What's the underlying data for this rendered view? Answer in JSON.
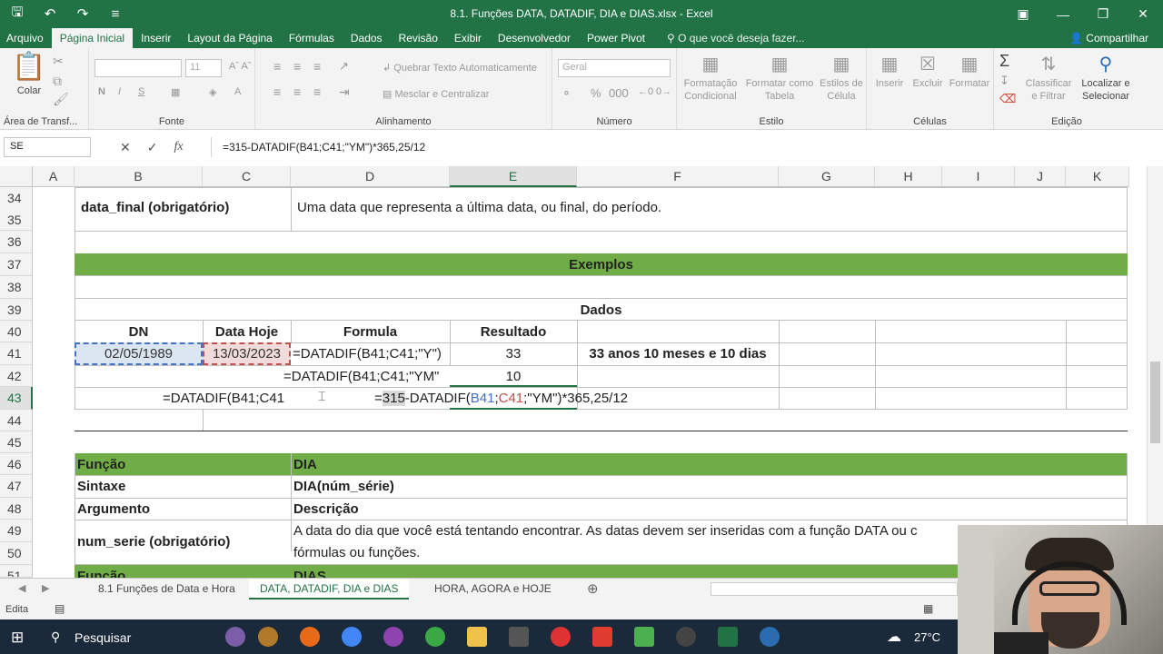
{
  "window": {
    "title": "8.1. Funções DATA, DATADIF, DIA e DIAS.xlsx - Excel"
  },
  "ribbon_tabs": [
    "Arquivo",
    "Página Inicial",
    "Inserir",
    "Layout da Página",
    "Fórmulas",
    "Dados",
    "Revisão",
    "Exibir",
    "Desenvolvedor",
    "Power Pivot"
  ],
  "tell_me": "O que você deseja fazer...",
  "share": "Compartilhar",
  "ribbon": {
    "paste": "Colar",
    "clipboard_group": "Área de Transf...",
    "font_size": "11",
    "font_group": "Fonte",
    "wrap_text": "Quebrar Texto Automaticamente",
    "merge_center": "Mesclar e Centralizar",
    "alignment_group": "Alinhamento",
    "number_format": "Geral",
    "number_group": "Número",
    "cond_format": "Formatação Condicional",
    "format_table": "Formatar como Tabela",
    "cell_styles": "Estilos de Célula",
    "styles_group": "Estilo",
    "insert": "Inserir",
    "delete": "Excluir",
    "format": "Formatar",
    "cells_group": "Células",
    "sort_filter": "Classificar e Filtrar",
    "find_select": "Localizar e Selecionar",
    "editing_group": "Edição"
  },
  "formula_bar": {
    "name_box": "SE",
    "formula": "=315-DATADIF(B41;C41;\"YM\")*365,25/12"
  },
  "columns": [
    "A",
    "B",
    "C",
    "D",
    "E",
    "F",
    "G",
    "H",
    "I",
    "J",
    "K"
  ],
  "rows": [
    "34",
    "35",
    "36",
    "37",
    "38",
    "39",
    "40",
    "41",
    "42",
    "43",
    "44",
    "45",
    "46",
    "47",
    "48",
    "49",
    "50",
    "51"
  ],
  "cells": {
    "b34": "data_final (obrigatório)",
    "d34": "Uma data que representa a última data, ou final, do período.",
    "exemplos": "Exemplos",
    "dados": "Dados",
    "h_dn": "DN",
    "h_hoje": "Data Hoje",
    "h_formula": "Formula",
    "h_resultado": "Resultado",
    "b41": "02/05/1989",
    "c41": "13/03/2023",
    "d41": "=DATADIF(B41;C41;\"Y\")",
    "e41": "33",
    "f41": "33 anos 10 meses e 10 dias",
    "d42": "=DATADIF(B41;C41;\"YM\"",
    "e42": "10",
    "b43": "=DATADIF(B41;C41",
    "e43_pre": "=",
    "e43_315": "315",
    "e43_mid": "-DATADIF(",
    "e43_b41": "B41",
    "e43_sep": ";",
    "e43_c41": "C41",
    "e43_post": ";\"YM\")*365,25/12",
    "b46": "Função",
    "d46": "DIA",
    "b47": "Sintaxe",
    "d47": "DIA(núm_série)",
    "b48": "Argumento",
    "d48": "Descrição",
    "b49": "num_serie (obrigatório)",
    "d49a": "A data do dia que você está tentando encontrar. As datas devem ser inseridas com a função DATA ou c",
    "d49b": "fórmulas ou funções.",
    "b51": "Função",
    "d51": "DIAS"
  },
  "sheets": [
    "8.1 Funções de Data e Hora",
    "DATA, DATADIF, DIA e DIAS",
    "HORA, AGORA e HOJE"
  ],
  "status": "Edita",
  "taskbar": {
    "search": "Pesquisar",
    "temperature": "27°C"
  }
}
